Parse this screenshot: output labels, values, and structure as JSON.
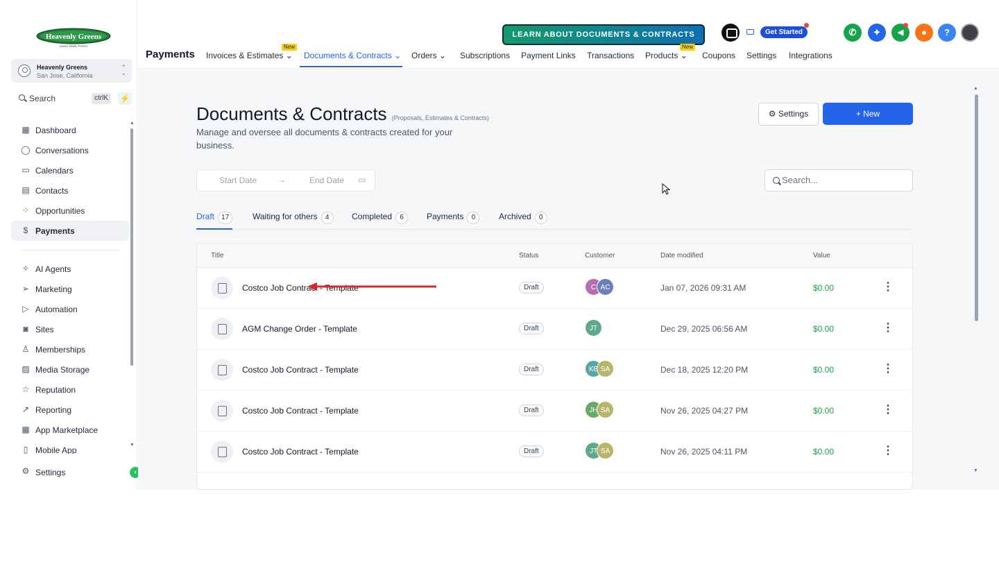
{
  "brand": {
    "logo_text": "Heavenly Greens",
    "logo_tagline": "Lawns Made Perfect",
    "colors": {
      "accent": "#2563eb",
      "success": "#16a34a",
      "logo_green": "#1f7a3a"
    }
  },
  "location": {
    "name": "Heavenly Greens",
    "address": "San Jose, California"
  },
  "sidebar": {
    "search_label": "Search",
    "shortcut": "ctrlK",
    "items_top": [
      {
        "label": "Dashboard",
        "icon": "grid-icon"
      },
      {
        "label": "Conversations",
        "icon": "chat-icon"
      },
      {
        "label": "Calendars",
        "icon": "calendar-icon"
      },
      {
        "label": "Contacts",
        "icon": "contacts-icon"
      },
      {
        "label": "Opportunities",
        "icon": "opportunities-icon"
      },
      {
        "label": "Payments",
        "icon": "payments-icon"
      }
    ],
    "items_bottom": [
      {
        "label": "AI Agents",
        "icon": "sparkle-icon"
      },
      {
        "label": "Marketing",
        "icon": "send-icon"
      },
      {
        "label": "Automation",
        "icon": "play-icon"
      },
      {
        "label": "Sites",
        "icon": "sites-icon"
      },
      {
        "label": "Memberships",
        "icon": "award-icon"
      },
      {
        "label": "Media Storage",
        "icon": "image-icon"
      },
      {
        "label": "Reputation",
        "icon": "star-icon"
      },
      {
        "label": "Reporting",
        "icon": "trend-icon"
      },
      {
        "label": "App Marketplace",
        "icon": "apps-icon"
      },
      {
        "label": "Mobile App",
        "icon": "mobile-icon"
      }
    ],
    "settings_label": "Settings"
  },
  "topbar": {
    "learn_button": "LEARN ABOUT DOCUMENTS & CONTRACTS",
    "get_started": "Get Started",
    "section_title": "Payments",
    "tabs": [
      {
        "label": "Invoices & Estimates",
        "chevron": true,
        "badge": "New"
      },
      {
        "label": "Documents & Contracts",
        "chevron": true
      },
      {
        "label": "Orders",
        "chevron": true
      },
      {
        "label": "Subscriptions"
      },
      {
        "label": "Payment Links"
      },
      {
        "label": "Transactions"
      },
      {
        "label": "Products",
        "chevron": true,
        "badge": "New"
      },
      {
        "label": "Coupons"
      },
      {
        "label": "Settings"
      },
      {
        "label": "Integrations"
      }
    ],
    "circle_icons": [
      {
        "name": "phone-icon",
        "color": "#16a34a",
        "glyph": "✆"
      },
      {
        "name": "ai-sparkle-icon",
        "color": "#2563eb",
        "glyph": "✦"
      },
      {
        "name": "megaphone-icon",
        "color": "#16a34a",
        "glyph": "◀"
      },
      {
        "name": "bell-icon",
        "color": "#f97316",
        "glyph": "●"
      },
      {
        "name": "help-icon",
        "color": "#3b82f6",
        "glyph": "?"
      }
    ]
  },
  "page": {
    "title": "Documents & Contracts",
    "title_sub": "(Proposals, Estimates & Contracts)",
    "description": "Manage and oversee all documents & contracts created for your business.",
    "settings_button": "Settings",
    "new_button": "+ New",
    "start_date_placeholder": "Start Date",
    "end_date_placeholder": "End Date",
    "search_placeholder": "Search...",
    "status_tabs": [
      {
        "label": "Draft",
        "count": "17"
      },
      {
        "label": "Waiting for others",
        "count": "4"
      },
      {
        "label": "Completed",
        "count": "6"
      },
      {
        "label": "Payments",
        "count": "0"
      },
      {
        "label": "Archived",
        "count": "0"
      }
    ],
    "columns": [
      "Title",
      "Status",
      "Customer",
      "Date modified",
      "Value"
    ],
    "rows": [
      {
        "title": "Costco Job Contract - Template",
        "status": "Draft",
        "avatars": [
          {
            "t": "C",
            "c": "#b56fae"
          },
          {
            "t": "AC",
            "c": "#6d7fb8"
          }
        ],
        "date": "Jan 07, 2026 09:31 AM",
        "value": "$0.00"
      },
      {
        "title": "AGM Change Order - Template",
        "status": "Draft",
        "avatars": [
          {
            "t": "JT",
            "c": "#5fa88a"
          }
        ],
        "date": "Dec 29, 2025 06:56 AM",
        "value": "$0.00"
      },
      {
        "title": "Costco Job Contract - Template",
        "status": "Draft",
        "avatars": [
          {
            "t": "KE",
            "c": "#5aa5a5"
          },
          {
            "t": "SA",
            "c": "#b8b46a"
          }
        ],
        "date": "Dec 18, 2025 12:20 PM",
        "value": "$0.00"
      },
      {
        "title": "Costco Job Contract - Template",
        "status": "Draft",
        "avatars": [
          {
            "t": "JH",
            "c": "#6aa86a"
          },
          {
            "t": "SA",
            "c": "#b8b46a"
          }
        ],
        "date": "Nov 26, 2025 04:27 PM",
        "value": "$0.00"
      },
      {
        "title": "Costco Job Contract - Template",
        "status": "Draft",
        "avatars": [
          {
            "t": "JT",
            "c": "#5fa88a"
          },
          {
            "t": "SA",
            "c": "#b8b46a"
          }
        ],
        "date": "Nov 26, 2025 04:11 PM",
        "value": "$0.00"
      }
    ]
  }
}
